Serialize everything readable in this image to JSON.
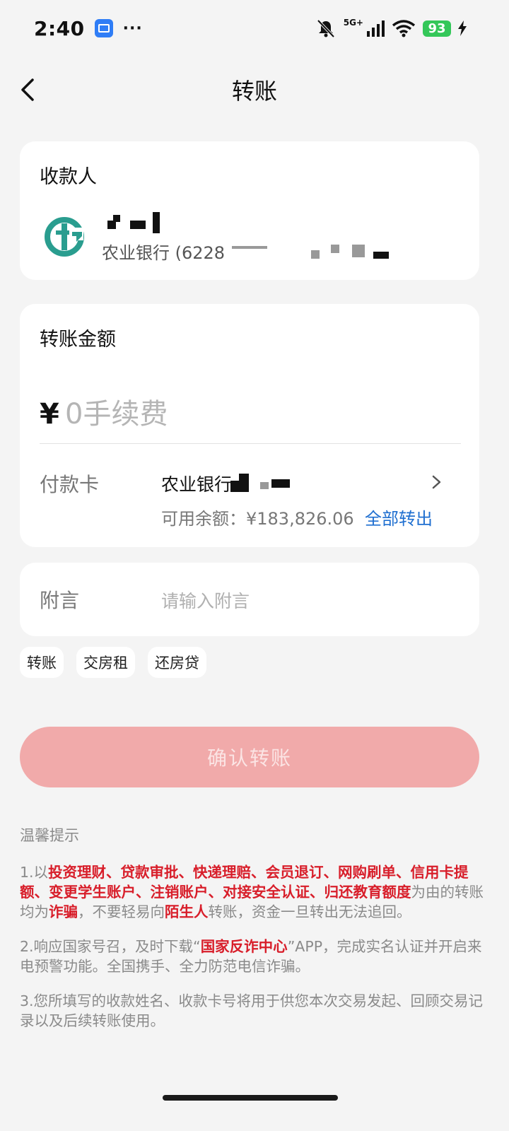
{
  "status_bar": {
    "time": "2:40",
    "more": "···",
    "network": "5G+",
    "battery": "93"
  },
  "header": {
    "title": "转账"
  },
  "payee": {
    "section_title": "收款人",
    "bank_prefix": "农业银行 (6228",
    "logo_icon": "abc-bank-logo",
    "accent_color": "#2a9d8f"
  },
  "amount": {
    "section_title": "转账金额",
    "currency_symbol": "¥",
    "placeholder": "0手续费"
  },
  "pay_card": {
    "label": "付款卡",
    "card_prefix": "农业银行",
    "balance_text": "可用余额：¥183,826.06",
    "transfer_all": "全部转出"
  },
  "memo": {
    "label": "附言",
    "placeholder": "请输入附言"
  },
  "chips": [
    "转账",
    "交房租",
    "还房贷"
  ],
  "confirm_button": "确认转账",
  "tips": {
    "title": "温馨提示",
    "t1_a": "1.以",
    "t1_red1": "投资理财、贷款审批、快递理赔、会员退订、网购刷单、信用卡提额、变更学生账户、注销账户、对接安全认证、归还教育额度",
    "t1_b": "为由的转账均为",
    "t1_red2": "诈骗",
    "t1_c": "，不要轻易向",
    "t1_red3": "陌生人",
    "t1_d": "转账，资金一旦转出无法追回。",
    "t2_a": "2.响应国家号召，及时下载“",
    "t2_red": "国家反诈中心",
    "t2_b": "”APP，完成实名认证并开启来电预警功能。全国携手、全力防范电信诈骗。",
    "t3": "3.您所填写的收款姓名、收款卡号将用于供您本次交易发起、回顾交易记录以及后续转账使用。"
  },
  "colors": {
    "primary_blue": "#1f6fd0",
    "warning_red": "#d81e2a",
    "confirm_disabled": "#f1aaaa"
  }
}
